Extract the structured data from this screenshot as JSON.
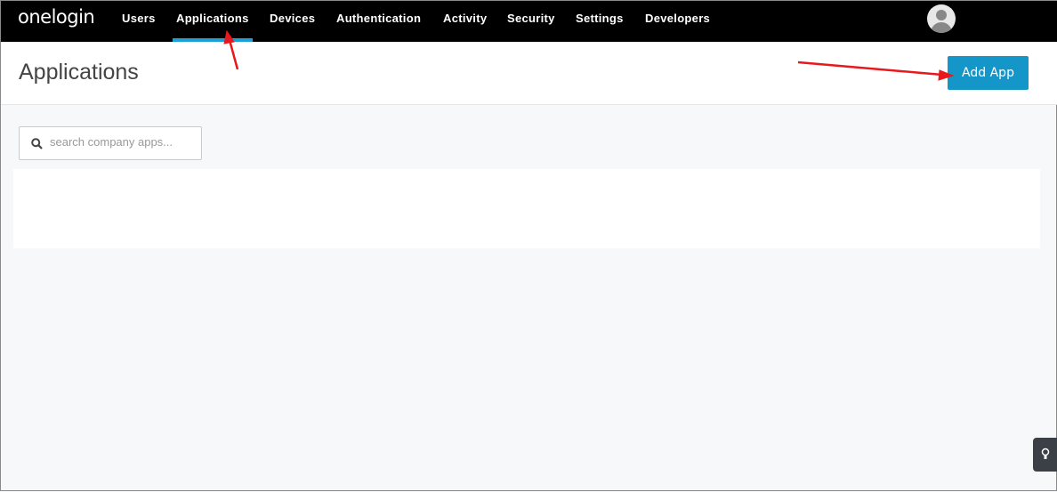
{
  "nav": {
    "logo": "onelogin",
    "items": [
      "Users",
      "Applications",
      "Devices",
      "Authentication",
      "Activity",
      "Security",
      "Settings",
      "Developers"
    ],
    "active": "Applications"
  },
  "header": {
    "title": "Applications",
    "add_button": "Add App"
  },
  "search": {
    "placeholder": "search company apps...",
    "value": ""
  },
  "colors": {
    "accent": "#1596c8",
    "nav_bg": "#000000",
    "annotation": "#e8191c"
  }
}
